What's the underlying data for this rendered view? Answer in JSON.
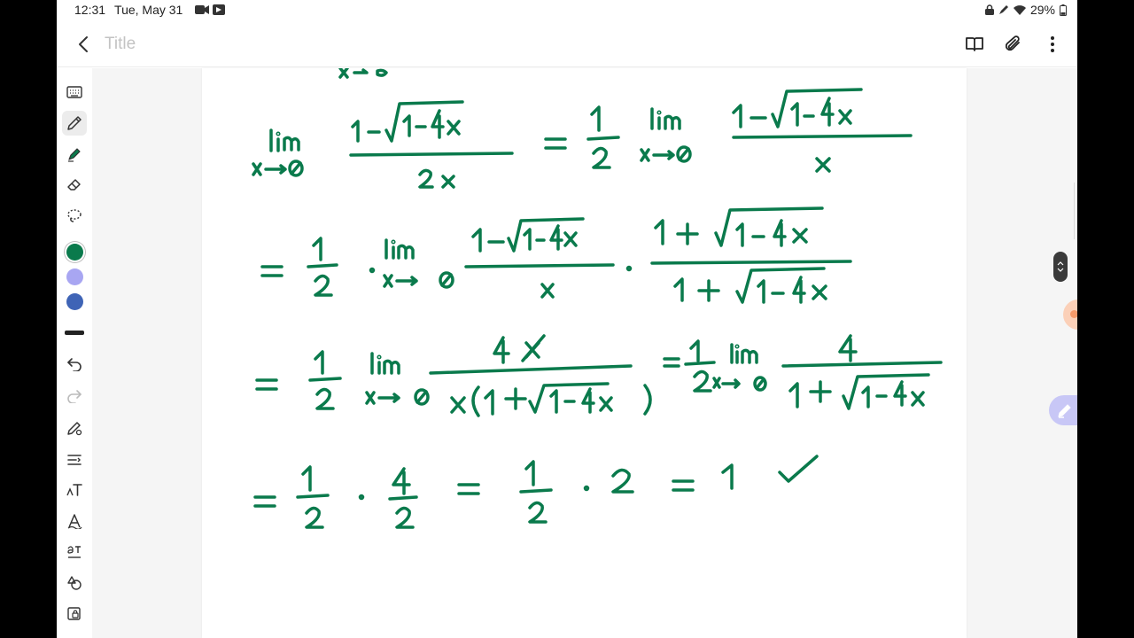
{
  "status_bar": {
    "time": "12:31",
    "date": "Tue, May 31",
    "battery": "29%",
    "icons": [
      "video-camera-icon",
      "media-icon",
      "lock-icon",
      "pen-mode-icon",
      "wifi-icon",
      "battery-icon"
    ]
  },
  "app_bar": {
    "title_placeholder": "Title",
    "left_icon": "back-arrow-icon",
    "right_icons": [
      "book-view-icon",
      "attach-icon",
      "more-vertical-icon"
    ]
  },
  "toolbar": {
    "tools": [
      "keyboard-icon",
      "pen-icon",
      "highlighter-icon",
      "eraser-icon",
      "lasso-icon",
      "color-green",
      "color-lavender",
      "color-blue",
      "thickness",
      "undo-icon",
      "redo-icon",
      "pen-settings-icon",
      "text-align-icon",
      "text-format-icon",
      "handwriting-icon",
      "text-convert-icon",
      "shapes-icon",
      "image-lock-icon"
    ],
    "selected_tool": "pen-icon",
    "colors": {
      "green": "#0a7a4c",
      "lavender": "#a8a6f2",
      "blue": "#3f64b6"
    },
    "selected_color": "green"
  },
  "note": {
    "ink_color": "#0a7a4c",
    "content_type": "handwritten-math"
  }
}
